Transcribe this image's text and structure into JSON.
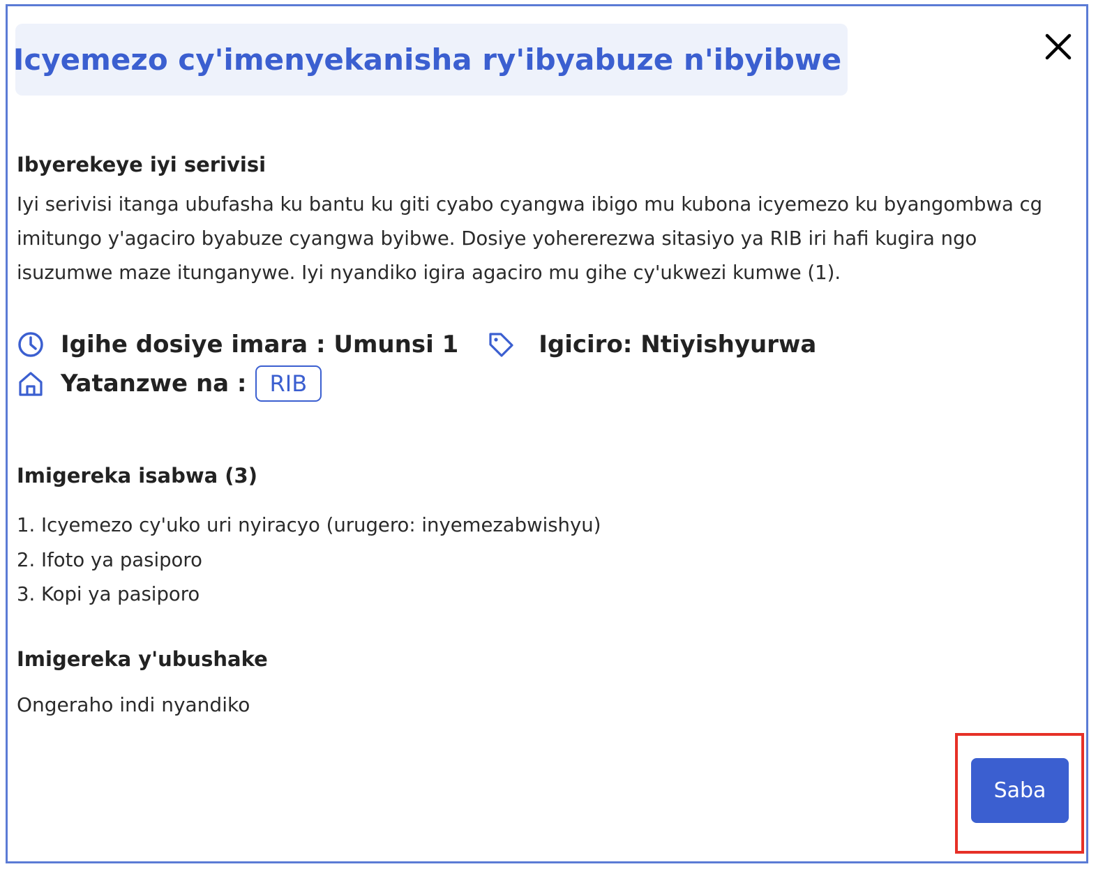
{
  "modal": {
    "title": "Icyemezo cy'imenyekanisha ry'ibyabuze n'ibyibwe",
    "close_icon": "close-icon"
  },
  "about": {
    "heading": "Ibyerekeye iyi serivisi",
    "description": "Iyi serivisi itanga ubufasha ku bantu ku giti cyabo cyangwa ibigo mu kubona icyemezo ku byangombwa cg imitungo y'agaciro byabuze cyangwa byibwe. Dosiye yohererezwa sitasiyo ya RIB iri hafi kugira ngo isuzumwe maze itunganywe. Iyi nyandiko igira agaciro mu gihe cy'ukwezi kumwe (1)."
  },
  "meta": {
    "duration": "Igihe dosiye imara : Umunsi 1",
    "price": "Igiciro: Ntiyishyurwa",
    "provider_label": "Yatanzwe na :",
    "provider": "RIB"
  },
  "requirements": {
    "heading": "Imigereka isabwa (3)",
    "items": [
      "1. Icyemezo cy'uko uri nyiracyo (urugero: inyemezabwishyu)",
      "2. Ifoto ya pasiporo",
      "3. Kopi ya pasiporo"
    ]
  },
  "optional": {
    "heading": "Imigereka y'ubushake",
    "add_more": "Ongeraho indi nyandiko"
  },
  "actions": {
    "apply_label": "Saba"
  },
  "colors": {
    "accent": "#3b5fd0",
    "title_bg": "#eef2fb",
    "highlight": "#e63027"
  }
}
